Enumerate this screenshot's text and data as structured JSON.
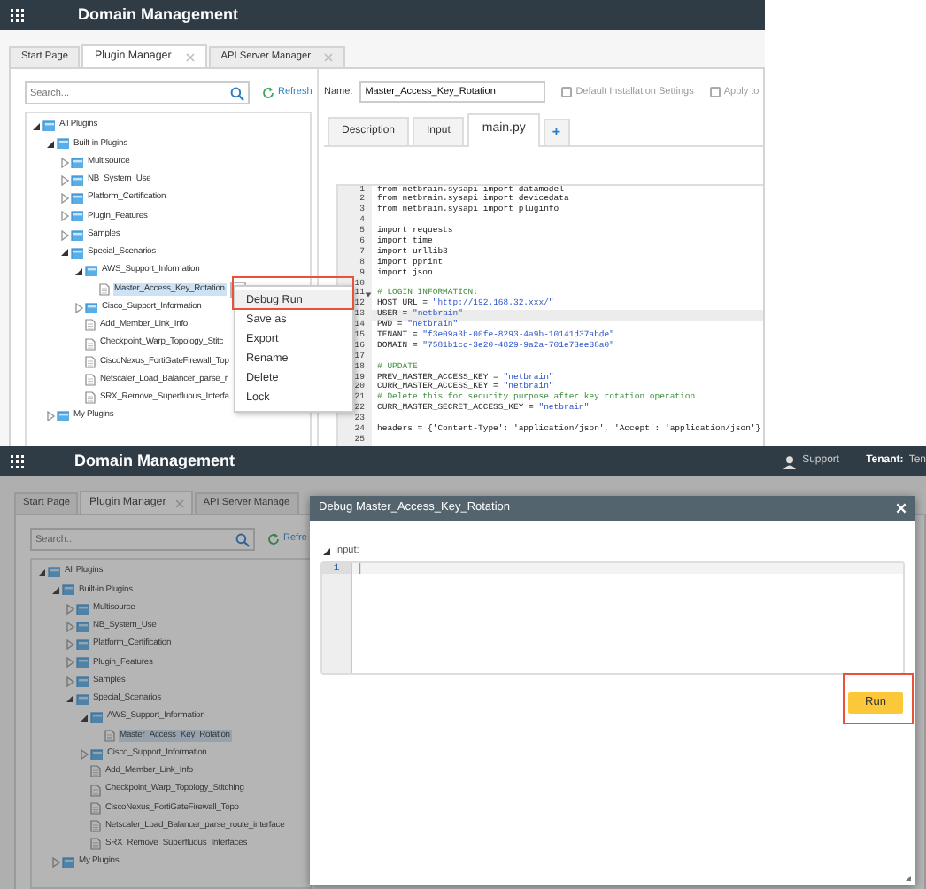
{
  "top_screen": {
    "header": {
      "title": "Domain Management"
    },
    "tabs": [
      {
        "label": "Start Page",
        "selected": false
      },
      {
        "label": "Plugin Manager",
        "selected": true,
        "closable": true
      },
      {
        "label": "API Server Manager",
        "selected": false,
        "closable": true
      }
    ],
    "search": {
      "placeholder": "Search..."
    },
    "refresh": "Refresh",
    "tree": [
      {
        "label": "All Plugins",
        "kind": "folder",
        "expanded": true,
        "selected": false,
        "children": [
          {
            "label": "Built-in Plugins",
            "kind": "folder",
            "expanded": true,
            "selected": false,
            "children": [
              {
                "label": "Multisource",
                "kind": "folder",
                "expanded": false,
                "selected": false
              },
              {
                "label": "NB_System_Use",
                "kind": "folder",
                "expanded": false,
                "selected": false
              },
              {
                "label": "Platform_Certification",
                "kind": "folder",
                "expanded": false,
                "selected": false
              },
              {
                "label": "Plugin_Features",
                "kind": "folder",
                "expanded": false,
                "selected": false
              },
              {
                "label": "Samples",
                "kind": "folder",
                "expanded": false,
                "selected": false
              },
              {
                "label": "Special_Scenarios",
                "kind": "folder",
                "expanded": true,
                "selected": false,
                "children": [
                  {
                    "label": "AWS_Support_Information",
                    "kind": "folder",
                    "expanded": true,
                    "selected": false,
                    "children": [
                      {
                        "label": "Master_Access_Key_Rotation",
                        "kind": "file",
                        "selected": true,
                        "menu_caret": true
                      }
                    ]
                  },
                  {
                    "label": "Cisco_Support_Information",
                    "kind": "folder",
                    "expanded": false,
                    "selected": false
                  },
                  {
                    "label": "Add_Member_Link_Info",
                    "kind": "file",
                    "selected": false
                  },
                  {
                    "label": "Checkpoint_Warp_Topology_Stitc",
                    "kind": "file",
                    "selected": false
                  },
                  {
                    "label": "CiscoNexus_FortiGateFirewall_Top",
                    "kind": "file",
                    "selected": false
                  },
                  {
                    "label": "Netscaler_Load_Balancer_parse_r",
                    "kind": "file",
                    "selected": false
                  },
                  {
                    "label": "SRX_Remove_Superfluous_Interfa",
                    "kind": "file",
                    "selected": false
                  }
                ]
              }
            ]
          },
          {
            "label": "My Plugins",
            "kind": "folder",
            "expanded": false,
            "selected": false
          }
        ]
      }
    ],
    "name_label": "Name:",
    "name_value": "Master_Access_Key_Rotation",
    "checkboxes": [
      {
        "label": "Default Installation Settings",
        "checked": false
      },
      {
        "label": "Apply to",
        "checked": false
      }
    ],
    "editor_tabs": [
      {
        "label": "Description",
        "selected": false,
        "kind": "tab"
      },
      {
        "label": "Input",
        "selected": false,
        "kind": "tab"
      },
      {
        "label": "main.py",
        "selected": true,
        "kind": "tab"
      },
      {
        "label": "+",
        "kind": "add"
      }
    ],
    "code": [
      {
        "n": "1",
        "text": "from netbrain.sysapi import datamodel",
        "kind": "code"
      },
      {
        "n": "2",
        "text": "from netbrain.sysapi import devicedata",
        "kind": "code"
      },
      {
        "n": "3",
        "text": "from netbrain.sysapi import pluginfo",
        "kind": "code"
      },
      {
        "n": "4",
        "kind": "blank"
      },
      {
        "n": "5",
        "text": "import requests",
        "kind": "code"
      },
      {
        "n": "6",
        "text": "import time",
        "kind": "code"
      },
      {
        "n": "7",
        "text": "import urllib3",
        "kind": "code"
      },
      {
        "n": "8",
        "text": "import pprint",
        "kind": "code"
      },
      {
        "n": "9",
        "text": "import json",
        "kind": "code"
      },
      {
        "n": "10",
        "kind": "blank"
      },
      {
        "n": "11",
        "text": "# LOGIN INFORMATION:",
        "kind": "comment",
        "foldable": true
      },
      {
        "n": "12",
        "text": "HOST_URL = \"http://192.168.32.xxx/\"",
        "kind": "code"
      },
      {
        "n": "13",
        "text": "USER = \"netbrain\"",
        "kind": "code",
        "current": true
      },
      {
        "n": "14",
        "text": "PWD = \"netbrain\"",
        "kind": "code"
      },
      {
        "n": "15",
        "text": "TENANT = \"f3e09a3b-00fe-8293-4a9b-10141d37abde\"",
        "kind": "code"
      },
      {
        "n": "16",
        "text": "DOMAIN = \"7581b1cd-3e20-4829-9a2a-701e73ee38a0\"",
        "kind": "code"
      },
      {
        "n": "17",
        "kind": "blank"
      },
      {
        "n": "18",
        "text": "# UPDATE",
        "kind": "comment"
      },
      {
        "n": "19",
        "text": "PREV_MASTER_ACCESS_KEY = \"netbrain\"",
        "kind": "code"
      },
      {
        "n": "20",
        "text": "CURR_MASTER_ACCESS_KEY = \"netbrain\"",
        "kind": "code"
      },
      {
        "n": "21",
        "text": "# Delete this for security purpose after key rotation operation",
        "kind": "comment"
      },
      {
        "n": "22",
        "text": "CURR_MASTER_SECRET_ACCESS_KEY = \"netbrain\"",
        "kind": "code"
      },
      {
        "n": "23",
        "kind": "blank"
      },
      {
        "n": "24",
        "text": "headers = {'Content-Type': 'application/json', 'Accept': 'application/json'}",
        "kind": "code"
      },
      {
        "n": "25",
        "kind": "blank"
      }
    ],
    "context_menu": [
      {
        "label": "Debug Run",
        "highlighted": true
      },
      {
        "label": "Save as"
      },
      {
        "label": "Export"
      },
      {
        "label": "Rename"
      },
      {
        "label": "Delete"
      },
      {
        "label": "Lock"
      }
    ]
  },
  "bottom_screen": {
    "header": {
      "title": "Domain Management",
      "support": "Support",
      "tenant_label": "Tenant:",
      "tenant_value": "Ten"
    },
    "tabs": [
      {
        "label": "Start Page",
        "selected": false
      },
      {
        "label": "Plugin Manager",
        "selected": true,
        "closable": true
      },
      {
        "label": "API Server Manage",
        "selected": false
      }
    ],
    "search": {
      "placeholder": "Search..."
    },
    "refresh": "Refre",
    "tree": [
      {
        "label": "All Plugins",
        "kind": "folder",
        "expanded": true,
        "selected": false,
        "children": [
          {
            "label": "Built-in Plugins",
            "kind": "folder",
            "expanded": true,
            "selected": false,
            "children": [
              {
                "label": "Multisource",
                "kind": "folder",
                "expanded": false,
                "selected": false
              },
              {
                "label": "NB_System_Use",
                "kind": "folder",
                "expanded": false,
                "selected": false
              },
              {
                "label": "Platform_Certification",
                "kind": "folder",
                "expanded": false,
                "selected": false
              },
              {
                "label": "Plugin_Features",
                "kind": "folder",
                "expanded": false,
                "selected": false
              },
              {
                "label": "Samples",
                "kind": "folder",
                "expanded": false,
                "selected": false
              },
              {
                "label": "Special_Scenarios",
                "kind": "folder",
                "expanded": true,
                "selected": false,
                "children": [
                  {
                    "label": "AWS_Support_Information",
                    "kind": "folder",
                    "expanded": true,
                    "selected": false,
                    "children": [
                      {
                        "label": "Master_Access_Key_Rotation",
                        "kind": "file",
                        "selected": true
                      }
                    ]
                  },
                  {
                    "label": "Cisco_Support_Information",
                    "kind": "folder",
                    "expanded": false,
                    "selected": false
                  },
                  {
                    "label": "Add_Member_Link_Info",
                    "kind": "file",
                    "selected": false
                  },
                  {
                    "label": "Checkpoint_Warp_Topology_Stitching",
                    "kind": "file",
                    "selected": false
                  },
                  {
                    "label": "CiscoNexus_FortiGateFirewall_Topo",
                    "kind": "file",
                    "selected": false
                  },
                  {
                    "label": "Netscaler_Load_Balancer_parse_route_interface",
                    "kind": "file",
                    "selected": false
                  },
                  {
                    "label": "SRX_Remove_Superfluous_Interfaces",
                    "kind": "file",
                    "selected": false
                  }
                ]
              }
            ]
          },
          {
            "label": "My Plugins",
            "kind": "folder",
            "expanded": false,
            "selected": false
          }
        ]
      }
    ],
    "dialog": {
      "title": "Debug Master_Access_Key_Rotation",
      "input_label": "Input:",
      "input_expanded": true,
      "lines": [
        "1"
      ],
      "run": "Run",
      "run_highlighted": true
    }
  }
}
